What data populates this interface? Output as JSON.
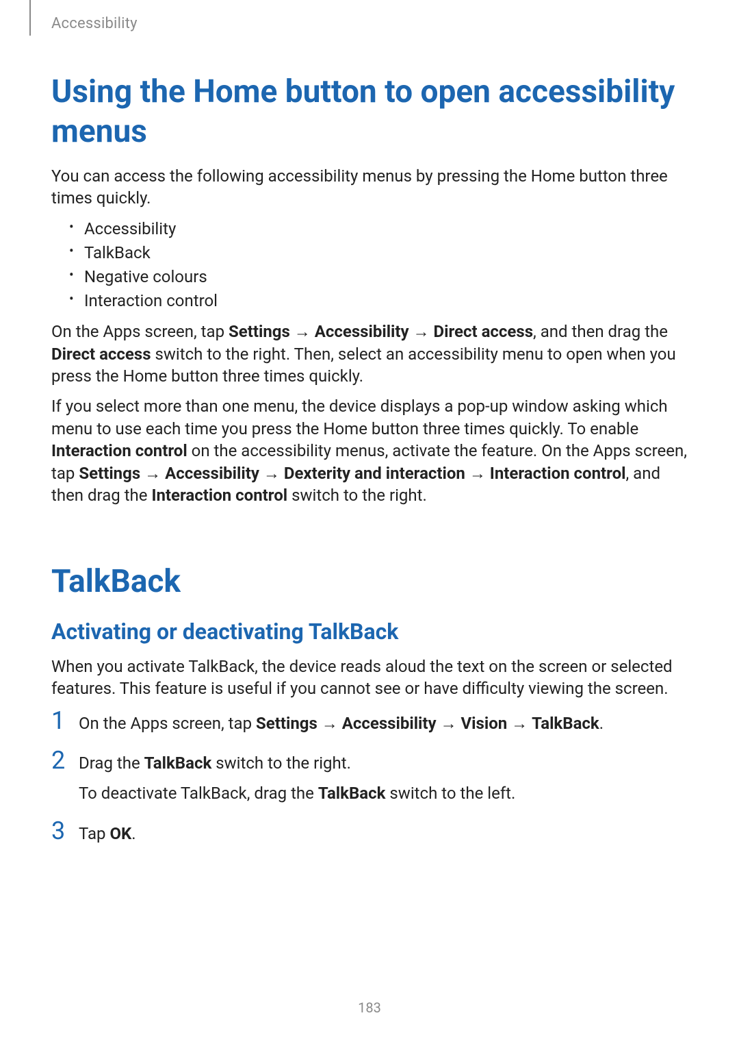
{
  "header": {
    "section": "Accessibility"
  },
  "title1": "Using the Home button to open accessibility menus",
  "intro1": "You can access the following accessibility menus by pressing the Home button three times quickly.",
  "bullets": [
    "Accessibility",
    "TalkBack",
    "Negative colours",
    "Interaction control"
  ],
  "para2": {
    "pre": "On the Apps screen, tap ",
    "b1": "Settings",
    "arrow1": " → ",
    "b2": "Accessibility",
    "arrow2": " → ",
    "b3": "Direct access",
    "mid": ", and then drag the ",
    "b4": "Direct access",
    "post": " switch to the right. Then, select an accessibility menu to open when you press the Home button three times quickly."
  },
  "para3": {
    "pre": "If you select more than one menu, the device displays a pop-up window asking which menu to use each time you press the Home button three times quickly. To enable ",
    "b1": "Interaction control",
    "mid1": " on the accessibility menus, activate the feature. On the Apps screen, tap ",
    "b2": "Settings",
    "arrow1": " → ",
    "b3": "Accessibility",
    "arrow2": " → ",
    "b4": "Dexterity and interaction",
    "arrow3": " → ",
    "b5": "Interaction control",
    "mid2": ", and then drag the ",
    "b6": "Interaction control",
    "post": " switch to the right."
  },
  "title2": "TalkBack",
  "subsection1": "Activating or deactivating TalkBack",
  "tb_intro": "When you activate TalkBack, the device reads aloud the text on the screen or selected features. This feature is useful if you cannot see or have difficulty viewing the screen.",
  "steps": {
    "s1": {
      "pre": "On the Apps screen, tap ",
      "b1": "Settings",
      "arrow1": " → ",
      "b2": "Accessibility",
      "arrow2": " → ",
      "b3": "Vision",
      "arrow3": " → ",
      "b4": "TalkBack",
      "post": "."
    },
    "s2": {
      "pre": "Drag the ",
      "b1": "TalkBack",
      "post": " switch to the right.",
      "sub_pre": "To deactivate TalkBack, drag the ",
      "sub_b1": "TalkBack",
      "sub_post": " switch to the left."
    },
    "s3": {
      "pre": "Tap ",
      "b1": "OK",
      "post": "."
    }
  },
  "page_number": "183"
}
